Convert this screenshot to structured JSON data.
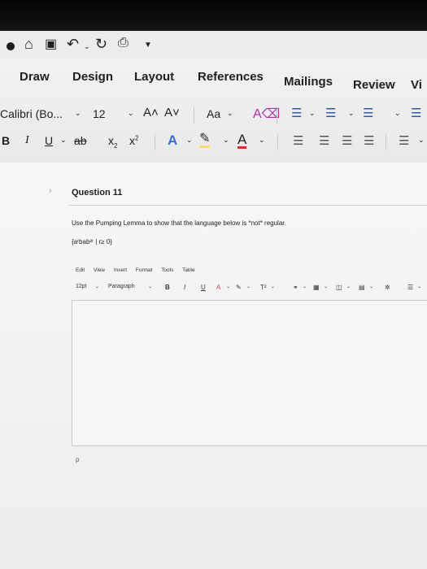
{
  "qat": {
    "icons": [
      "home-icon",
      "save-icon",
      "undo-icon",
      "redo-icon",
      "print-icon",
      "customize-icon"
    ]
  },
  "tabs": {
    "draw": "Draw",
    "design": "Design",
    "layout": "Layout",
    "references": "References",
    "mailings": "Mailings",
    "review": "Review",
    "view": "Vi"
  },
  "font": {
    "name": "Calibri (Bo...",
    "size": "12",
    "change_case": "Aa"
  },
  "question": {
    "title": "Question 11",
    "prompt": "Use the Pumping Lemma to show that the language below is *not* regular.",
    "language": "{aʳbab²ʳ | r≥ 0}"
  },
  "editor": {
    "menu": [
      "Edit",
      "View",
      "Insert",
      "Format",
      "Tools",
      "Table"
    ],
    "font_size": "12pt",
    "block_format": "Paragraph",
    "p_marker": "p"
  }
}
